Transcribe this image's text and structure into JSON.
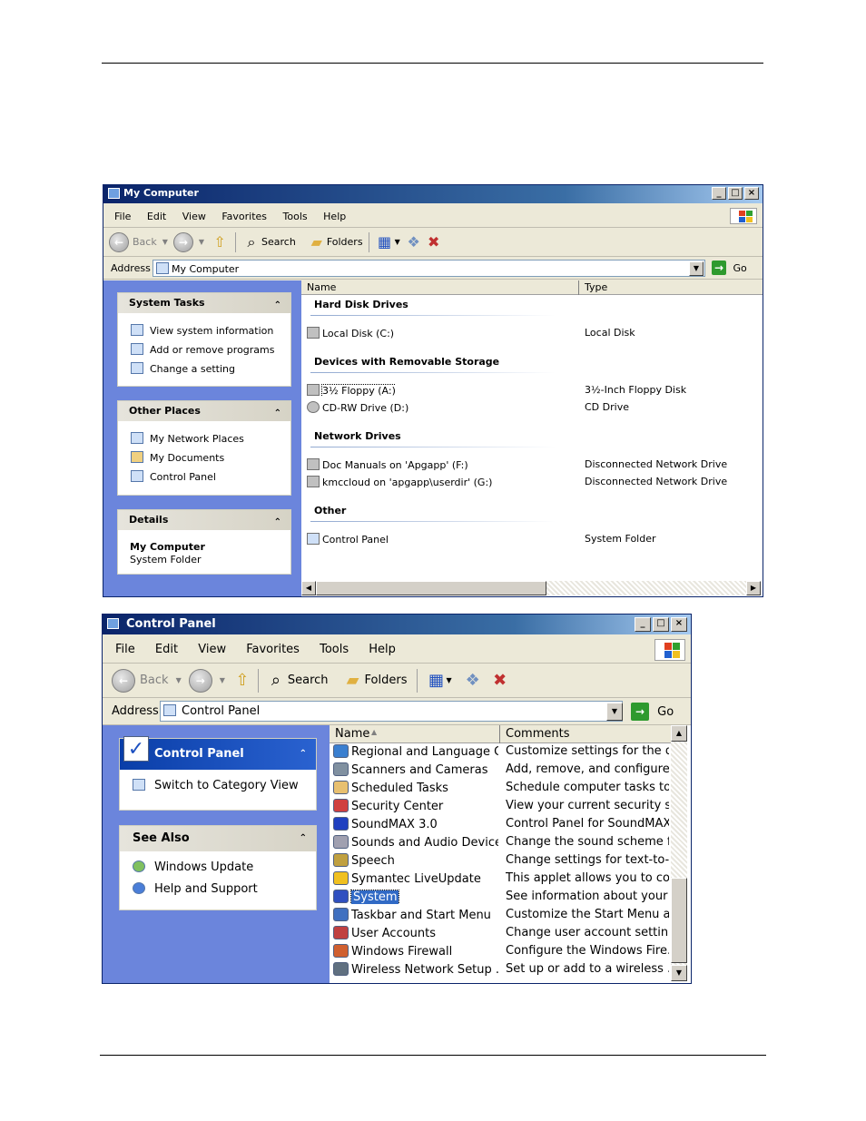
{
  "mycomputer": {
    "title": "My Computer",
    "menu": [
      "File",
      "Edit",
      "View",
      "Favorites",
      "Tools",
      "Help"
    ],
    "toolbar": {
      "back": "Back",
      "search": "Search",
      "folders": "Folders"
    },
    "address": {
      "label": "Address",
      "value": "My Computer",
      "go": "Go"
    },
    "tasks": {
      "system_tasks": {
        "title": "System Tasks",
        "items": [
          "View system information",
          "Add or remove programs",
          "Change a setting"
        ]
      },
      "other_places": {
        "title": "Other Places",
        "items": [
          "My Network Places",
          "My Documents",
          "Control Panel"
        ]
      },
      "details": {
        "title": "Details",
        "name": "My Computer",
        "type": "System Folder"
      }
    },
    "columns": {
      "name": "Name",
      "type": "Type"
    },
    "groups": [
      {
        "title": "Hard Disk Drives",
        "items": [
          {
            "name": "Local Disk (C:)",
            "type": "Local Disk"
          }
        ]
      },
      {
        "title": "Devices with Removable Storage",
        "items": [
          {
            "name": "3½ Floppy (A:)",
            "type": "3½-Inch Floppy Disk"
          },
          {
            "name": "CD-RW Drive (D:)",
            "type": "CD Drive"
          }
        ]
      },
      {
        "title": "Network Drives",
        "items": [
          {
            "name": "Doc Manuals on 'Apgapp' (F:)",
            "type": "Disconnected Network Drive"
          },
          {
            "name": "kmccloud on 'apgapp\\userdir' (G:)",
            "type": "Disconnected Network Drive"
          }
        ]
      },
      {
        "title": "Other",
        "items": [
          {
            "name": "Control Panel",
            "type": "System Folder"
          }
        ]
      }
    ]
  },
  "controlpanel": {
    "title": "Control Panel",
    "menu": [
      "File",
      "Edit",
      "View",
      "Favorites",
      "Tools",
      "Help"
    ],
    "toolbar": {
      "back": "Back",
      "search": "Search",
      "folders": "Folders"
    },
    "address": {
      "label": "Address",
      "value": "Control Panel",
      "go": "Go"
    },
    "panel": {
      "title": "Control Panel",
      "switch": "Switch to Category View"
    },
    "see_also": {
      "title": "See Also",
      "items": [
        "Windows Update",
        "Help and Support"
      ]
    },
    "columns": {
      "name": "Name",
      "comments": "Comments"
    },
    "selected": "System",
    "items": [
      {
        "name": "Regional and Language O...",
        "comment": "Customize settings for the d..."
      },
      {
        "name": "Scanners and Cameras",
        "comment": "Add, remove, and configure..."
      },
      {
        "name": "Scheduled Tasks",
        "comment": "Schedule computer tasks to ..."
      },
      {
        "name": "Security Center",
        "comment": "View your current security s..."
      },
      {
        "name": "SoundMAX 3.0",
        "comment": "Control Panel for SoundMAX..."
      },
      {
        "name": "Sounds and Audio Devices",
        "comment": "Change the sound scheme f..."
      },
      {
        "name": "Speech",
        "comment": "Change settings for text-to-..."
      },
      {
        "name": "Symantec LiveUpdate",
        "comment": "This applet allows you to co..."
      },
      {
        "name": "System",
        "comment": "See information about your ..."
      },
      {
        "name": "Taskbar and Start Menu",
        "comment": "Customize the Start Menu a..."
      },
      {
        "name": "User Accounts",
        "comment": "Change user account settin..."
      },
      {
        "name": "Windows Firewall",
        "comment": "Configure the Windows Fire..."
      },
      {
        "name": "Wireless Network Setup ...",
        "comment": "Set up or add to a wireless ..."
      }
    ]
  },
  "colors": {
    "titlebar": "#0a246a",
    "selection": "#316ac5",
    "chrome": "#ece9d8"
  }
}
